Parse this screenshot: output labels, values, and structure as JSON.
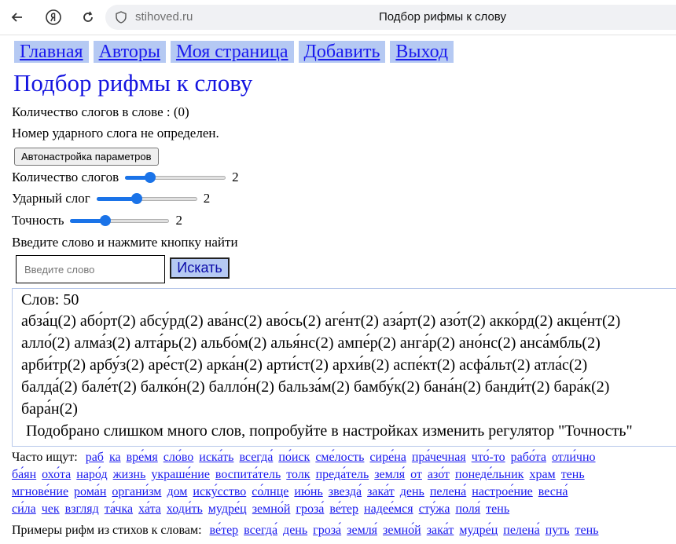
{
  "browser": {
    "domain": "stihoved.ru",
    "title": "Подбор рифмы к слову"
  },
  "menu": [
    "Главная",
    "Авторы",
    "Моя страница",
    "Добавить",
    "Выход"
  ],
  "heading": "Подбор рифмы к слову",
  "syllable_count_text": "Количество слогов в слове : (0)",
  "stress_text": "Номер ударного слога не определен.",
  "auto_button": "Автонастройка параметров",
  "sliders": [
    {
      "label": "Количество слогов",
      "value": "2",
      "level": 0.25
    },
    {
      "label": "Ударный слог",
      "value": "2",
      "level": 0.4
    },
    {
      "label": "Точность",
      "value": "2",
      "level": 0.35
    }
  ],
  "prompt_text": "Введите слово и нажмите кнопку найти",
  "search": {
    "placeholder": "Введите слово",
    "button": "Искать"
  },
  "results": {
    "count_label": "Слов: 50",
    "lines": [
      "абза́ц(2) або́рт(2) абсу́рд(2) ава́нс(2) аво́сь(2) аге́нт(2) аза́рт(2) азо́т(2) акко́рд(2) акце́нт(2)",
      "алло́(2) алма́з(2) алта́рь(2) альбо́м(2) алья́нс(2) ампе́р(2) анга́р(2) ано́нс(2) анса́мбль(2)",
      "арби́тр(2) арбу́з(2) аре́ст(2) арка́н(2) арти́ст(2) архи́в(2) аспе́кт(2) асфа́льт(2) атла́с(2)",
      "балда́(2) бале́т(2) балко́н(2) балло́н(2) бальза́м(2) бамбу́к(2) бана́н(2) банди́т(2) бара́к(2)",
      "бара́н(2)"
    ],
    "warning": "Подобрано слишком много слов, попробуйте в настройках изменить регулятор \"Точность\""
  },
  "frequent": {
    "label": "Часто ищут:",
    "rows": [
      [
        "раб",
        "ка",
        "вре́мя",
        "сло́во",
        "иска́ть",
        "всегда́",
        "по́иск",
        "сме́лость",
        "сире́на",
        "пра́чечная",
        "что́-то",
        "рабо́та",
        "отли́чно"
      ],
      [
        "ба́ян",
        "охо́та",
        "наро́д",
        "жизнь",
        "украше́ние",
        "воспита́тель",
        "толк",
        "преда́тель",
        "земля́",
        "от",
        "азо́т",
        "понеде́льник",
        "храм",
        "тень"
      ],
      [
        "мгнове́ние",
        "рома́н",
        "органи́зм",
        "дом",
        "иску́сство",
        "со́лнце",
        "ию́нь",
        "звезда́",
        "зака́т",
        "день",
        "пелена́",
        "настрое́ние",
        "весна́"
      ],
      [
        "си́ла",
        "чек",
        "взгляд",
        "та́чка",
        "ха́та",
        "ходи́ть",
        "мудре́ц",
        "земно́й",
        "гроза́",
        "ве́тер",
        "надее́мся",
        "сту́жа",
        "поля́",
        "тень"
      ]
    ]
  },
  "examples": {
    "label": "Примеры рифм из стихов к словам:",
    "words": [
      "ве́тер",
      "всегда́",
      "день",
      "гроза́",
      "земля́",
      "земно́й",
      "зака́т",
      "мудре́ц",
      "пелена́",
      "путь",
      "тень"
    ]
  }
}
